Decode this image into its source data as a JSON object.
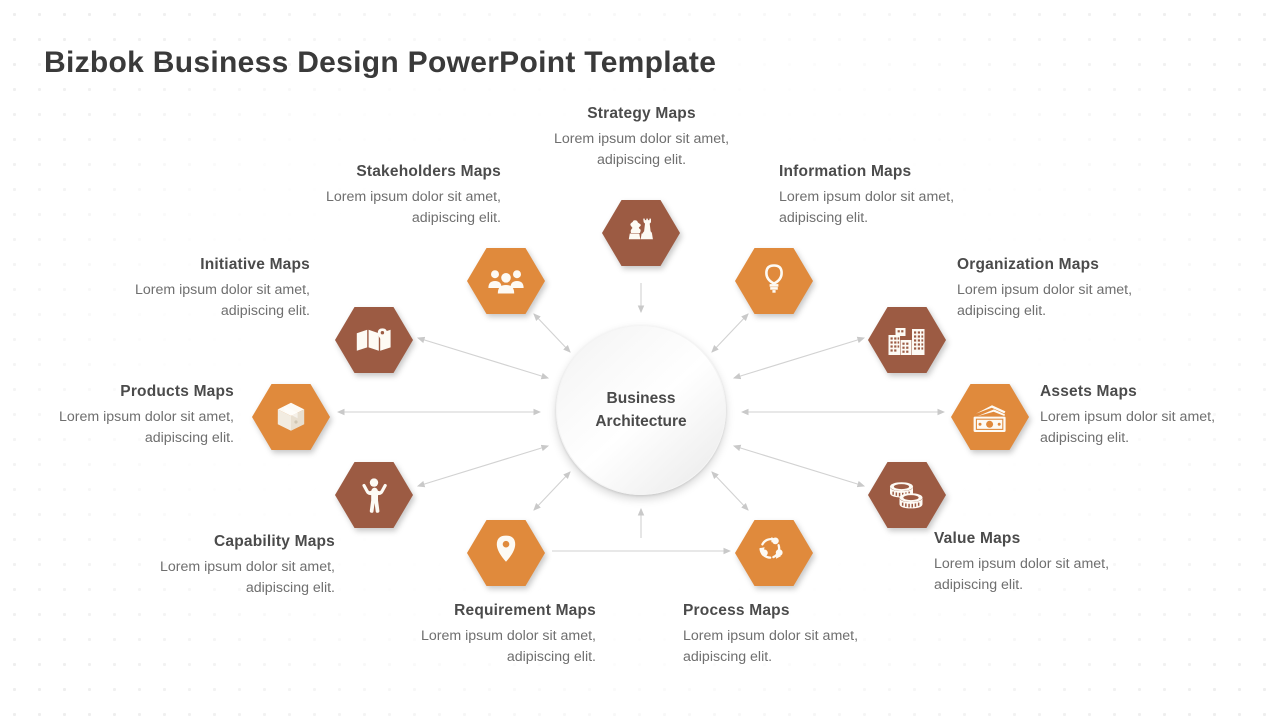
{
  "page": {
    "title": "Bizbok Business Design PowerPoint Template",
    "background_color": "#ffffff",
    "dot_pattern_color": "#eeeeee"
  },
  "center": {
    "line1": "Business",
    "line2": "Architecture",
    "shape": "circle",
    "fill": "#f4f4f4"
  },
  "colors": {
    "hex_orange": "#e08a3c",
    "hex_brown": "#9c5b43",
    "title_text": "#4b4b4b",
    "body_text": "#6f6f6f",
    "connector": "#cfcfcf"
  },
  "nodes": [
    {
      "id": "strategy",
      "title": "Strategy Maps",
      "desc_line1": "Lorem ipsum dolor sit amet,",
      "desc_line2": "adipiscing elit.",
      "icon": "chess-pieces-icon",
      "color": "#9c5b43",
      "align": "center"
    },
    {
      "id": "stakeholders",
      "title": "Stakeholders  Maps",
      "desc_line1": "Lorem ipsum dolor sit amet,",
      "desc_line2": "adipiscing elit.",
      "icon": "people-group-icon",
      "color": "#e08a3c",
      "align": "right"
    },
    {
      "id": "information",
      "title": "Information  Maps",
      "desc_line1": "Lorem ipsum dolor sit amet,",
      "desc_line2": "adipiscing elit.",
      "icon": "lightbulb-icon",
      "color": "#e08a3c",
      "align": "left"
    },
    {
      "id": "initiative",
      "title": "Initiative  Maps",
      "desc_line1": "Lorem ipsum dolor sit amet,",
      "desc_line2": "adipiscing elit.",
      "icon": "folded-map-pin-icon",
      "color": "#9c5b43",
      "align": "right"
    },
    {
      "id": "organization",
      "title": "Organization  Maps",
      "desc_line1": "Lorem ipsum dolor sit amet,",
      "desc_line2": "adipiscing elit.",
      "icon": "buildings-icon",
      "color": "#9c5b43",
      "align": "left"
    },
    {
      "id": "products",
      "title": "Products  Maps",
      "desc_line1": "Lorem ipsum dolor sit amet,",
      "desc_line2": "adipiscing elit.",
      "icon": "package-box-icon",
      "color": "#e08a3c",
      "align": "right"
    },
    {
      "id": "assets",
      "title": "Assets Maps",
      "desc_line1": "Lorem ipsum dolor sit amet,",
      "desc_line2": "adipiscing elit.",
      "icon": "banknotes-icon",
      "color": "#e08a3c",
      "align": "left"
    },
    {
      "id": "capability",
      "title": "Capability  Maps",
      "desc_line1": "Lorem ipsum dolor sit amet,",
      "desc_line2": "adipiscing elit.",
      "icon": "person-open-arms-icon",
      "color": "#9c5b43",
      "align": "right"
    },
    {
      "id": "value",
      "title": "Value Maps",
      "desc_line1": "Lorem ipsum dolor sit amet,",
      "desc_line2": "adipiscing elit.",
      "icon": "coin-stacks-icon",
      "color": "#9c5b43",
      "align": "left"
    },
    {
      "id": "requirement",
      "title": "Requirement Maps",
      "desc_line1": "Lorem ipsum dolor sit amet,",
      "desc_line2": "adipiscing elit.",
      "icon": "map-pin-icon",
      "color": "#e08a3c",
      "align": "right"
    },
    {
      "id": "process",
      "title": "Process  Maps",
      "desc_line1": "Lorem ipsum dolor sit amet,",
      "desc_line2": "adipiscing elit.",
      "icon": "cycle-arrows-icon",
      "color": "#e08a3c",
      "align": "left"
    }
  ]
}
